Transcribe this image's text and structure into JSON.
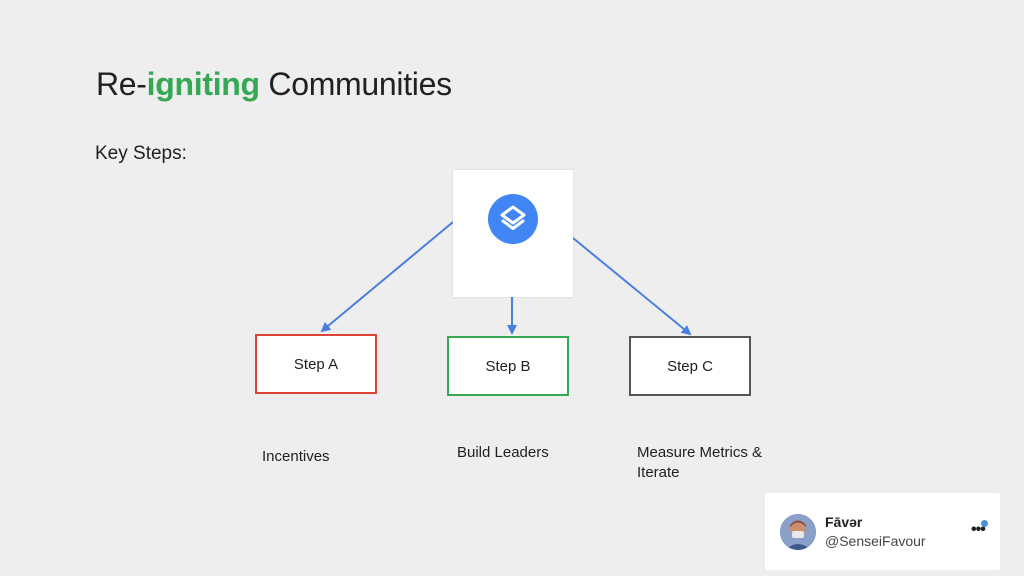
{
  "slide": {
    "title_prefix": "Re-",
    "title_accent": "igniting",
    "title_suffix": " Communities",
    "subtitle": "Key Steps:"
  },
  "diagram": {
    "root_icon": "layers-icon",
    "steps": [
      {
        "label": "Step A",
        "caption": "Incentives",
        "border_color": "#db4437"
      },
      {
        "label": "Step B",
        "caption": "Build Leaders",
        "border_color": "#34a853"
      },
      {
        "label": "Step C",
        "caption": "Measure Metrics & Iterate",
        "border_color": "#555555"
      }
    ],
    "arrow_color": "#4a7fe0"
  },
  "profile": {
    "name": "Fāvər",
    "handle": "@SenseiFavour",
    "icon": "more-icon"
  },
  "colors": {
    "accent": "#34a853",
    "logo": "#4285f4"
  }
}
